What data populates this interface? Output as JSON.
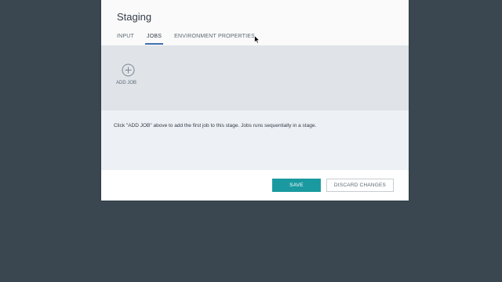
{
  "dialog": {
    "title": "Staging",
    "tabs": [
      {
        "label": "INPUT",
        "active": false
      },
      {
        "label": "JOBS",
        "active": true
      },
      {
        "label": "ENVIRONMENT PROPERTIES",
        "active": false
      }
    ],
    "add_job": {
      "icon": "plus-circle-icon",
      "label": "ADD JOB"
    },
    "empty_message": "Click \"ADD JOB\" above to add the first job to this stage. Jobs runs sequentially in a stage.",
    "footer": {
      "save_label": "SAVE",
      "discard_label": "DISCARD CHANGES"
    }
  },
  "colors": {
    "backdrop": "#3a4750",
    "accent_tab": "#3d70b2",
    "primary_button": "#1a9aa0",
    "jobs_strip": "#e0e4e9",
    "empty_area": "#edf0f4"
  }
}
